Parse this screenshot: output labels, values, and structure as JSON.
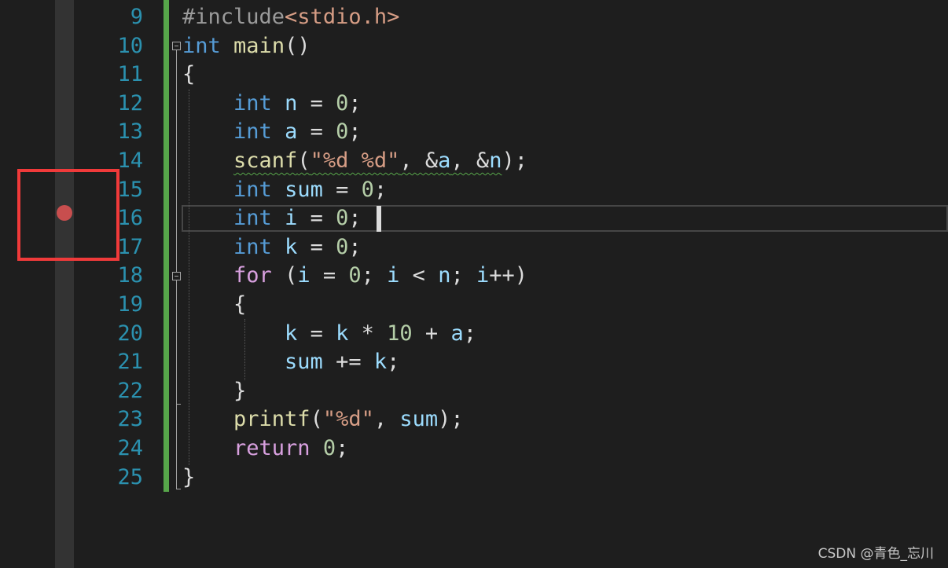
{
  "editor": {
    "line_numbers": [
      "9",
      "10",
      "11",
      "12",
      "13",
      "14",
      "15",
      "16",
      "17",
      "18",
      "19",
      "20",
      "21",
      "22",
      "23",
      "24",
      "25"
    ],
    "lines": [
      [
        [
          "pp",
          "#include"
        ],
        [
          "hdr",
          "<stdio.h>"
        ]
      ],
      [
        [
          "kw",
          "int"
        ],
        [
          "plain",
          " "
        ],
        [
          "fn",
          "main"
        ],
        [
          "plain",
          "()"
        ]
      ],
      [
        [
          "plain",
          "{"
        ]
      ],
      [
        [
          "plain",
          "    "
        ],
        [
          "kw",
          "int"
        ],
        [
          "plain",
          " "
        ],
        [
          "var",
          "n"
        ],
        [
          "plain",
          " = "
        ],
        [
          "num",
          "0"
        ],
        [
          "plain",
          ";"
        ]
      ],
      [
        [
          "plain",
          "    "
        ],
        [
          "kw",
          "int"
        ],
        [
          "plain",
          " "
        ],
        [
          "var",
          "a"
        ],
        [
          "plain",
          " = "
        ],
        [
          "num",
          "0"
        ],
        [
          "plain",
          ";"
        ]
      ],
      [
        [
          "plain",
          "    "
        ],
        [
          "fn_sq",
          "scanf"
        ],
        [
          "plain_sq",
          "("
        ],
        [
          "str_sq",
          "\"%d %d\""
        ],
        [
          "plain_sq",
          ", &"
        ],
        [
          "var_sq",
          "a"
        ],
        [
          "plain_sq",
          ", &"
        ],
        [
          "var_sq",
          "n"
        ],
        [
          "plain",
          ");"
        ]
      ],
      [
        [
          "plain",
          "    "
        ],
        [
          "kw",
          "int"
        ],
        [
          "plain",
          " "
        ],
        [
          "var",
          "sum"
        ],
        [
          "plain",
          " = "
        ],
        [
          "num",
          "0"
        ],
        [
          "plain",
          ";"
        ]
      ],
      [
        [
          "plain",
          "    "
        ],
        [
          "kw",
          "int"
        ],
        [
          "plain",
          " "
        ],
        [
          "var",
          "i"
        ],
        [
          "plain",
          " = "
        ],
        [
          "num",
          "0"
        ],
        [
          "plain",
          ";"
        ]
      ],
      [
        [
          "plain",
          "    "
        ],
        [
          "kw",
          "int"
        ],
        [
          "plain",
          " "
        ],
        [
          "var",
          "k"
        ],
        [
          "plain",
          " = "
        ],
        [
          "num",
          "0"
        ],
        [
          "plain",
          ";"
        ]
      ],
      [
        [
          "plain",
          "    "
        ],
        [
          "ctl",
          "for"
        ],
        [
          "plain",
          " ("
        ],
        [
          "var",
          "i"
        ],
        [
          "plain",
          " = "
        ],
        [
          "num",
          "0"
        ],
        [
          "plain",
          "; "
        ],
        [
          "var",
          "i"
        ],
        [
          "plain",
          " < "
        ],
        [
          "var",
          "n"
        ],
        [
          "plain",
          "; "
        ],
        [
          "var",
          "i"
        ],
        [
          "plain",
          "++)"
        ]
      ],
      [
        [
          "plain",
          "    {"
        ]
      ],
      [
        [
          "plain",
          "        "
        ],
        [
          "var",
          "k"
        ],
        [
          "plain",
          " = "
        ],
        [
          "var",
          "k"
        ],
        [
          "plain",
          " * "
        ],
        [
          "num",
          "10"
        ],
        [
          "plain",
          " + "
        ],
        [
          "var",
          "a"
        ],
        [
          "plain",
          ";"
        ]
      ],
      [
        [
          "plain",
          "        "
        ],
        [
          "var",
          "sum"
        ],
        [
          "plain",
          " += "
        ],
        [
          "var",
          "k"
        ],
        [
          "plain",
          ";"
        ]
      ],
      [
        [
          "plain",
          "    }"
        ]
      ],
      [
        [
          "plain",
          "    "
        ],
        [
          "fn",
          "printf"
        ],
        [
          "plain",
          "("
        ],
        [
          "str",
          "\"%d\""
        ],
        [
          "plain",
          ", "
        ],
        [
          "var",
          "sum"
        ],
        [
          "plain",
          ");"
        ]
      ],
      [
        [
          "plain",
          "    "
        ],
        [
          "ctl",
          "return"
        ],
        [
          "plain",
          " "
        ],
        [
          "num",
          "0"
        ],
        [
          "plain",
          ";"
        ]
      ],
      [
        [
          "plain",
          "}"
        ]
      ]
    ],
    "current_line": "16",
    "breakpoint_line": "16"
  },
  "colors": {
    "background": "#1e1e1e",
    "line_number": "#2b91af",
    "change_bar": "#57a64a",
    "breakpoint": "#c84e4e",
    "highlight_box": "#f03a3a"
  },
  "watermark": "CSDN @青色_忘川"
}
